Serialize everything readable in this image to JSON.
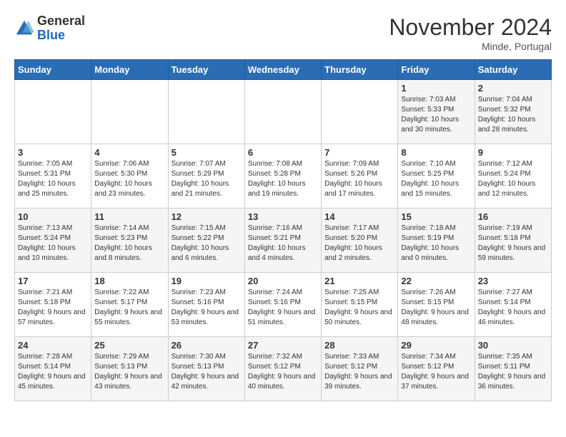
{
  "header": {
    "logo_line1": "General",
    "logo_line2": "Blue",
    "month": "November 2024",
    "location": "Minde, Portugal"
  },
  "days_of_week": [
    "Sunday",
    "Monday",
    "Tuesday",
    "Wednesday",
    "Thursday",
    "Friday",
    "Saturday"
  ],
  "weeks": [
    [
      {
        "day": "",
        "sunrise": "",
        "sunset": "",
        "daylight": ""
      },
      {
        "day": "",
        "sunrise": "",
        "sunset": "",
        "daylight": ""
      },
      {
        "day": "",
        "sunrise": "",
        "sunset": "",
        "daylight": ""
      },
      {
        "day": "",
        "sunrise": "",
        "sunset": "",
        "daylight": ""
      },
      {
        "day": "",
        "sunrise": "",
        "sunset": "",
        "daylight": ""
      },
      {
        "day": "1",
        "sunrise": "Sunrise: 7:03 AM",
        "sunset": "Sunset: 5:33 PM",
        "daylight": "Daylight: 10 hours and 30 minutes."
      },
      {
        "day": "2",
        "sunrise": "Sunrise: 7:04 AM",
        "sunset": "Sunset: 5:32 PM",
        "daylight": "Daylight: 10 hours and 28 minutes."
      }
    ],
    [
      {
        "day": "3",
        "sunrise": "Sunrise: 7:05 AM",
        "sunset": "Sunset: 5:31 PM",
        "daylight": "Daylight: 10 hours and 25 minutes."
      },
      {
        "day": "4",
        "sunrise": "Sunrise: 7:06 AM",
        "sunset": "Sunset: 5:30 PM",
        "daylight": "Daylight: 10 hours and 23 minutes."
      },
      {
        "day": "5",
        "sunrise": "Sunrise: 7:07 AM",
        "sunset": "Sunset: 5:29 PM",
        "daylight": "Daylight: 10 hours and 21 minutes."
      },
      {
        "day": "6",
        "sunrise": "Sunrise: 7:08 AM",
        "sunset": "Sunset: 5:28 PM",
        "daylight": "Daylight: 10 hours and 19 minutes."
      },
      {
        "day": "7",
        "sunrise": "Sunrise: 7:09 AM",
        "sunset": "Sunset: 5:26 PM",
        "daylight": "Daylight: 10 hours and 17 minutes."
      },
      {
        "day": "8",
        "sunrise": "Sunrise: 7:10 AM",
        "sunset": "Sunset: 5:25 PM",
        "daylight": "Daylight: 10 hours and 15 minutes."
      },
      {
        "day": "9",
        "sunrise": "Sunrise: 7:12 AM",
        "sunset": "Sunset: 5:24 PM",
        "daylight": "Daylight: 10 hours and 12 minutes."
      }
    ],
    [
      {
        "day": "10",
        "sunrise": "Sunrise: 7:13 AM",
        "sunset": "Sunset: 5:24 PM",
        "daylight": "Daylight: 10 hours and 10 minutes."
      },
      {
        "day": "11",
        "sunrise": "Sunrise: 7:14 AM",
        "sunset": "Sunset: 5:23 PM",
        "daylight": "Daylight: 10 hours and 8 minutes."
      },
      {
        "day": "12",
        "sunrise": "Sunrise: 7:15 AM",
        "sunset": "Sunset: 5:22 PM",
        "daylight": "Daylight: 10 hours and 6 minutes."
      },
      {
        "day": "13",
        "sunrise": "Sunrise: 7:16 AM",
        "sunset": "Sunset: 5:21 PM",
        "daylight": "Daylight: 10 hours and 4 minutes."
      },
      {
        "day": "14",
        "sunrise": "Sunrise: 7:17 AM",
        "sunset": "Sunset: 5:20 PM",
        "daylight": "Daylight: 10 hours and 2 minutes."
      },
      {
        "day": "15",
        "sunrise": "Sunrise: 7:18 AM",
        "sunset": "Sunset: 5:19 PM",
        "daylight": "Daylight: 10 hours and 0 minutes."
      },
      {
        "day": "16",
        "sunrise": "Sunrise: 7:19 AM",
        "sunset": "Sunset: 5:18 PM",
        "daylight": "Daylight: 9 hours and 59 minutes."
      }
    ],
    [
      {
        "day": "17",
        "sunrise": "Sunrise: 7:21 AM",
        "sunset": "Sunset: 5:18 PM",
        "daylight": "Daylight: 9 hours and 57 minutes."
      },
      {
        "day": "18",
        "sunrise": "Sunrise: 7:22 AM",
        "sunset": "Sunset: 5:17 PM",
        "daylight": "Daylight: 9 hours and 55 minutes."
      },
      {
        "day": "19",
        "sunrise": "Sunrise: 7:23 AM",
        "sunset": "Sunset: 5:16 PM",
        "daylight": "Daylight: 9 hours and 53 minutes."
      },
      {
        "day": "20",
        "sunrise": "Sunrise: 7:24 AM",
        "sunset": "Sunset: 5:16 PM",
        "daylight": "Daylight: 9 hours and 51 minutes."
      },
      {
        "day": "21",
        "sunrise": "Sunrise: 7:25 AM",
        "sunset": "Sunset: 5:15 PM",
        "daylight": "Daylight: 9 hours and 50 minutes."
      },
      {
        "day": "22",
        "sunrise": "Sunrise: 7:26 AM",
        "sunset": "Sunset: 5:15 PM",
        "daylight": "Daylight: 9 hours and 48 minutes."
      },
      {
        "day": "23",
        "sunrise": "Sunrise: 7:27 AM",
        "sunset": "Sunset: 5:14 PM",
        "daylight": "Daylight: 9 hours and 46 minutes."
      }
    ],
    [
      {
        "day": "24",
        "sunrise": "Sunrise: 7:28 AM",
        "sunset": "Sunset: 5:14 PM",
        "daylight": "Daylight: 9 hours and 45 minutes."
      },
      {
        "day": "25",
        "sunrise": "Sunrise: 7:29 AM",
        "sunset": "Sunset: 5:13 PM",
        "daylight": "Daylight: 9 hours and 43 minutes."
      },
      {
        "day": "26",
        "sunrise": "Sunrise: 7:30 AM",
        "sunset": "Sunset: 5:13 PM",
        "daylight": "Daylight: 9 hours and 42 minutes."
      },
      {
        "day": "27",
        "sunrise": "Sunrise: 7:32 AM",
        "sunset": "Sunset: 5:12 PM",
        "daylight": "Daylight: 9 hours and 40 minutes."
      },
      {
        "day": "28",
        "sunrise": "Sunrise: 7:33 AM",
        "sunset": "Sunset: 5:12 PM",
        "daylight": "Daylight: 9 hours and 39 minutes."
      },
      {
        "day": "29",
        "sunrise": "Sunrise: 7:34 AM",
        "sunset": "Sunset: 5:12 PM",
        "daylight": "Daylight: 9 hours and 37 minutes."
      },
      {
        "day": "30",
        "sunrise": "Sunrise: 7:35 AM",
        "sunset": "Sunset: 5:11 PM",
        "daylight": "Daylight: 9 hours and 36 minutes."
      }
    ]
  ]
}
